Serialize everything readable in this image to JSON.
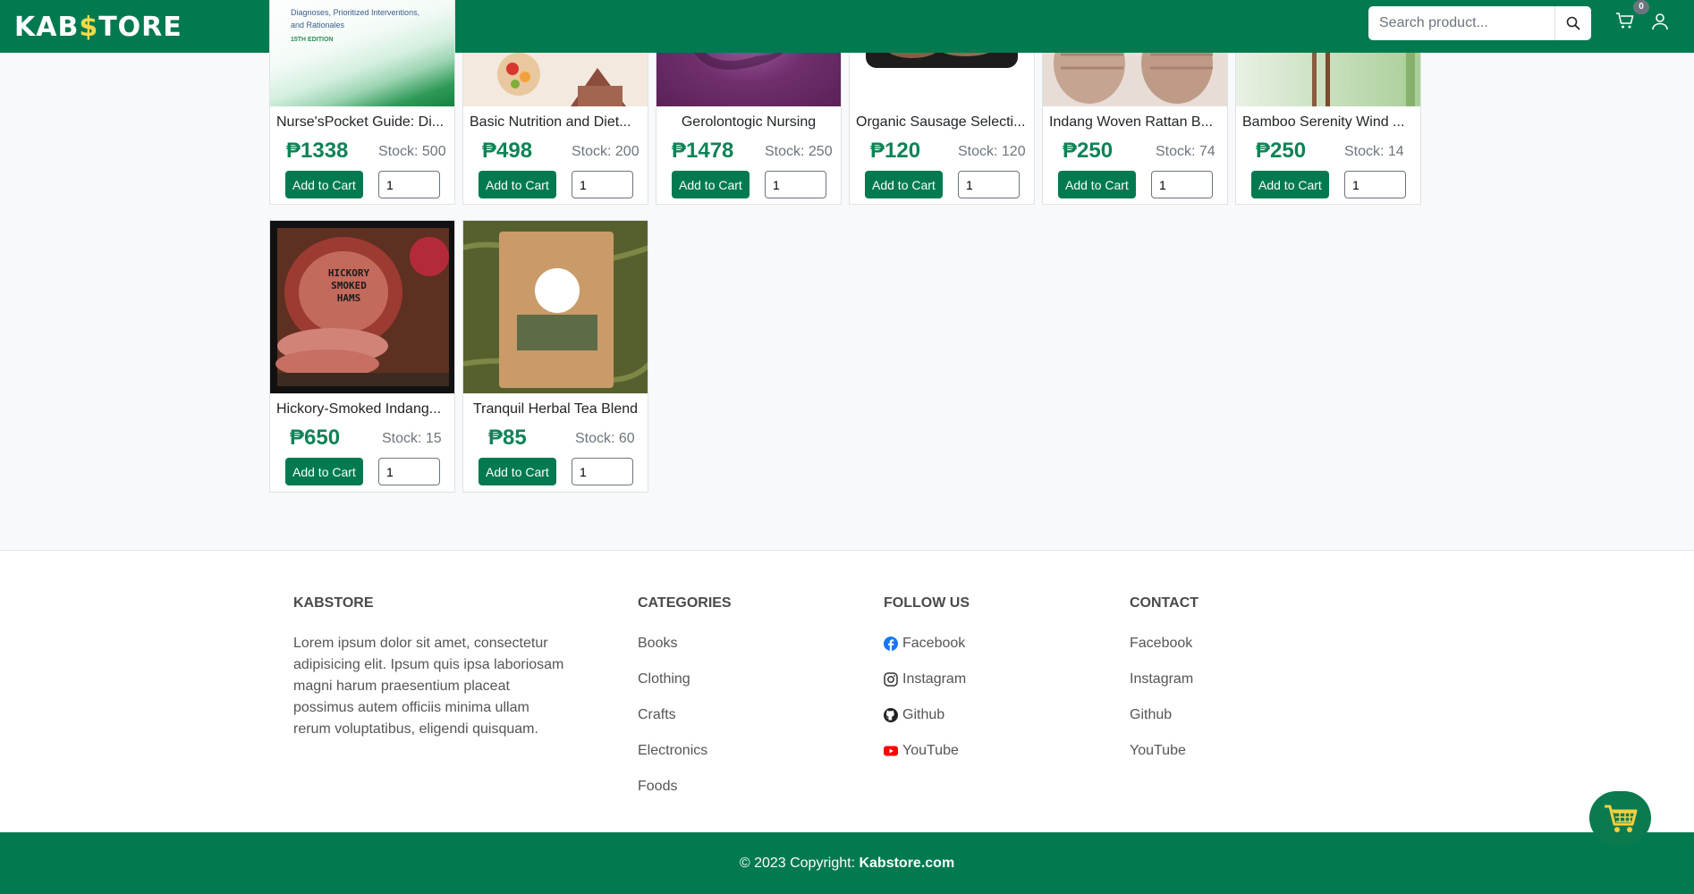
{
  "header": {
    "brand_pre": "KAB",
    "brand_dollar": "$",
    "brand_post": "TORE",
    "search_placeholder": "Search product...",
    "cart_count": "0",
    "accent_color": "#017a4f"
  },
  "top_book_cover": {
    "line1": "Diagnoses, Prioritized Interventions,",
    "line2": "and Rationales",
    "line3": "15TH EDITION"
  },
  "products_row1": [
    {
      "title": "Nurse'sPocket Guide: Di...",
      "price": "₱1338",
      "stock": "Stock: 500",
      "add_label": "Add to Cart",
      "qty": "1"
    },
    {
      "title": "Basic Nutrition and Diet...",
      "price": "₱498",
      "stock": "Stock: 200",
      "add_label": "Add to Cart",
      "qty": "1"
    },
    {
      "title": "Gerolontogic Nursing",
      "price": "₱1478",
      "stock": "Stock: 250",
      "add_label": "Add to Cart",
      "qty": "1"
    },
    {
      "title": "Organic Sausage Selecti...",
      "price": "₱120",
      "stock": "Stock: 120",
      "add_label": "Add to Cart",
      "qty": "1"
    },
    {
      "title": "Indang Woven Rattan B...",
      "price": "₱250",
      "stock": "Stock: 74",
      "add_label": "Add to Cart",
      "qty": "1"
    },
    {
      "title": "Bamboo Serenity Wind ...",
      "price": "₱250",
      "stock": "Stock: 14",
      "add_label": "Add to Cart",
      "qty": "1"
    }
  ],
  "products_row2": [
    {
      "title": "Hickory-Smoked Indang...",
      "price": "₱650",
      "stock": "Stock: 15",
      "add_label": "Add to Cart",
      "qty": "1",
      "image_text": [
        "HICKORY",
        "SMOKED",
        "HAMS"
      ]
    },
    {
      "title": "Tranquil Herbal Tea Blend",
      "price": "₱85",
      "stock": "Stock: 60",
      "add_label": "Add to Cart",
      "qty": "1"
    }
  ],
  "footer": {
    "about_heading": "KABSTORE",
    "about_text": "Lorem ipsum dolor sit amet, consectetur adipisicing elit. Ipsum quis ipsa laboriosam magni harum praesentium placeat possimus autem officiis minima ullam rerum voluptatibus, eligendi quisquam.",
    "categories_heading": "CATEGORIES",
    "categories": [
      "Books",
      "Clothing",
      "Crafts",
      "Electronics",
      "Foods"
    ],
    "follow_heading": "FOLLOW US",
    "follow": [
      "Facebook",
      "Instagram",
      "Github",
      "YouTube"
    ],
    "contact_heading": "CONTACT",
    "contact": [
      "Facebook",
      "Instagram",
      "Github",
      "YouTube"
    ],
    "copyright_prefix": "© 2023 Copyright: ",
    "copyright_site": "Kabstore.com"
  }
}
